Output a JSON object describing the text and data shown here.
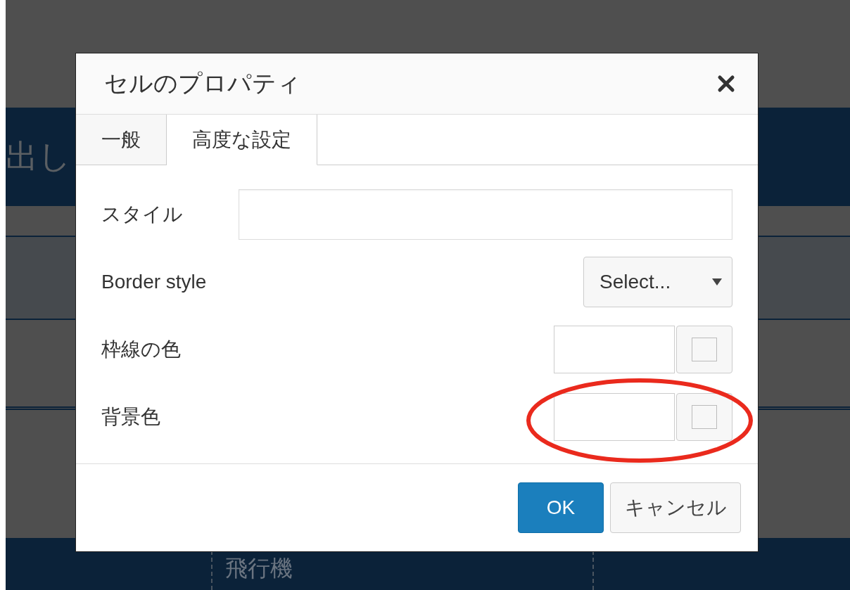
{
  "background": {
    "header_text": "出し",
    "bottom_cell": "飛行機"
  },
  "dialog": {
    "title": "セルのプロパティ",
    "tabs": [
      {
        "label": "一般",
        "selected": false
      },
      {
        "label": "高度な設定",
        "selected": true
      }
    ],
    "fields": [
      {
        "kind": "text",
        "label": "スタイル",
        "circled": false
      },
      {
        "kind": "select",
        "label": "Border style",
        "value": "Select...",
        "circled": false
      },
      {
        "kind": "color",
        "label": "枠線の色",
        "circled": false
      },
      {
        "kind": "color",
        "label": "背景色",
        "circled": true
      }
    ],
    "buttons": [
      {
        "label": "OK",
        "kind": "primary"
      },
      {
        "label": "キャンセル",
        "kind": "secondary"
      }
    ]
  }
}
